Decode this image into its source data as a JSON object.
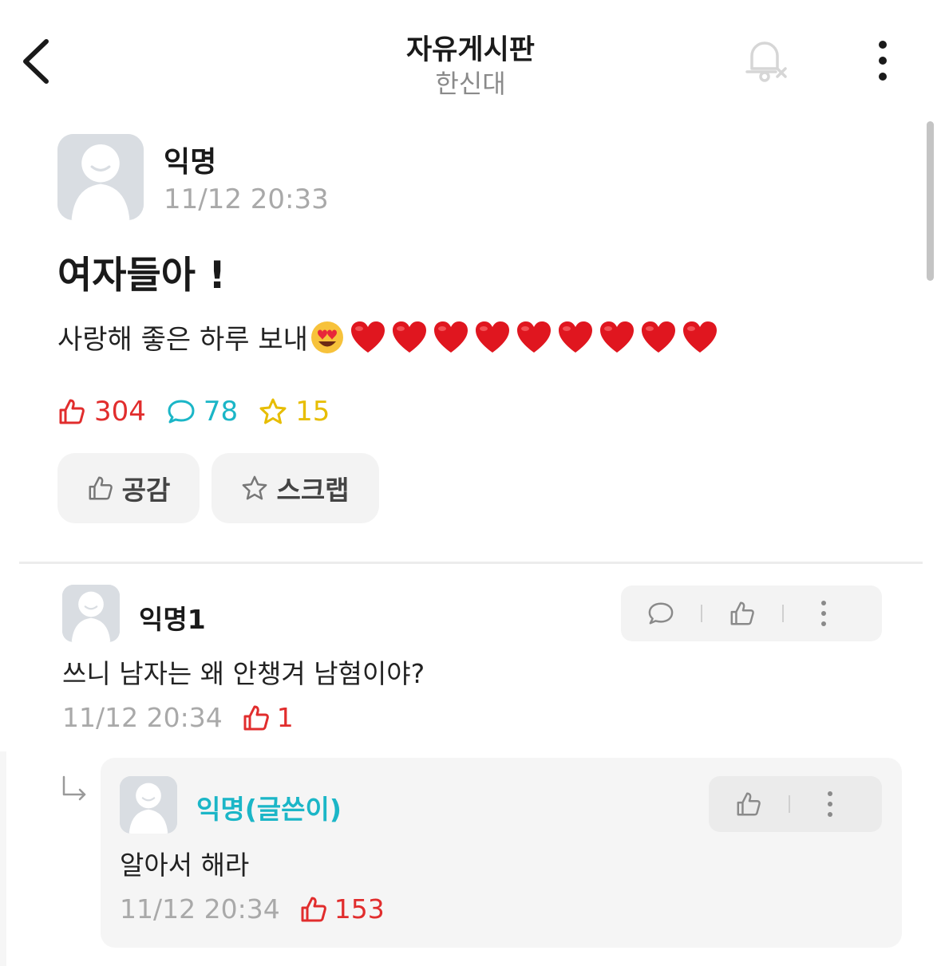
{
  "header": {
    "title": "자유게시판",
    "subtitle": "한신대",
    "back_icon": "chevron-left-icon",
    "notification_icon": "bell-off-icon",
    "more_icon": "more-vertical-icon"
  },
  "post": {
    "author": "익명",
    "time": "11/12 20:33",
    "title": "여자들아 !",
    "body": "사랑해 좋은 하루 보내",
    "emojis": [
      "heart-eyes-emoji",
      "red-heart",
      "red-heart",
      "red-heart",
      "red-heart",
      "red-heart",
      "red-heart",
      "red-heart",
      "red-heart",
      "red-heart"
    ],
    "stats": {
      "likes": "304",
      "comments": "78",
      "scraps": "15"
    },
    "buttons": {
      "like": "공감",
      "scrap": "스크랩"
    }
  },
  "comments": [
    {
      "author": "익명1",
      "text": "쓰니 남자는 왜 안챙겨 남혐이야?",
      "time": "11/12 20:34",
      "likes": "1",
      "replies": [
        {
          "author": "익명(글쓴이)",
          "text": "알아서 해라",
          "time": "11/12 20:34",
          "likes": "153"
        }
      ]
    }
  ],
  "colors": {
    "like": "#e12d2d",
    "comment": "#1bb6c7",
    "scrap": "#e7bd00",
    "author_highlight": "#1bb6c7",
    "muted": "#a9a9a9"
  }
}
